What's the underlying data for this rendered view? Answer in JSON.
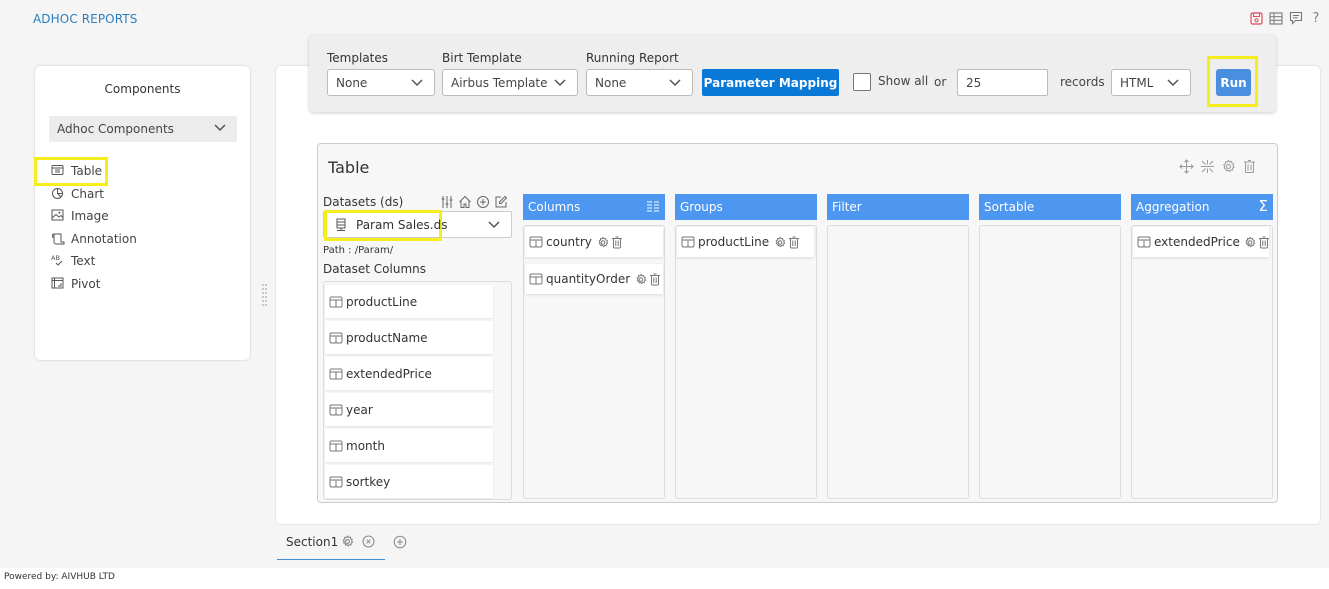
{
  "app": {
    "title": "ADHOC REPORTS",
    "top_icons": [
      "save-icon",
      "table-grid-icon",
      "comment-icon",
      "help-icon"
    ],
    "help_glyph": "?",
    "accent_color": "#2a7fc1"
  },
  "components_panel": {
    "title": "Components",
    "select_value": "Adhoc Components",
    "items": [
      {
        "label": "Table",
        "icon": "table-icon",
        "highlighted": true
      },
      {
        "label": "Chart",
        "icon": "pie-chart-icon"
      },
      {
        "label": "Image",
        "icon": "image-icon"
      },
      {
        "label": "Annotation",
        "icon": "annotation-icon"
      },
      {
        "label": "Text",
        "icon": "text-icon"
      },
      {
        "label": "Pivot",
        "icon": "pivot-icon"
      }
    ]
  },
  "toolbar": {
    "templates_label": "Templates",
    "templates_value": "None",
    "birt_label": "Birt Template",
    "birt_value": "Airbus Template",
    "running_label": "Running Report",
    "running_value": "None",
    "parameter_mapping": "Parameter Mapping",
    "show_all_label": "Show all",
    "show_all_checked": false,
    "or_label": "or",
    "records_value": "25",
    "records_label": "records",
    "format_value": "HTML",
    "run_label": "Run",
    "button_color": "#0a78d7"
  },
  "table_component": {
    "title": "Table",
    "action_icons": [
      "move-icon",
      "collapse-icon",
      "gear-icon",
      "trash-icon"
    ],
    "datasets_label": "Datasets (ds)",
    "dataset_icons": [
      "filter-sliders-icon",
      "home-icon",
      "add-circle-icon",
      "edit-icon"
    ],
    "dataset_value": "Param Sales.ds",
    "path_text": "Path : /Param/",
    "dataset_columns_label": "Dataset Columns",
    "dataset_columns": [
      "productLine",
      "productName",
      "extendedPrice",
      "year",
      "month",
      "sortkey"
    ],
    "drop_zones": [
      {
        "title": "Columns",
        "header_icon": "list-columns-icon",
        "items": [
          "country",
          "quantityOrder"
        ]
      },
      {
        "title": "Groups",
        "items": [
          "productLine"
        ]
      },
      {
        "title": "Filter",
        "items": []
      },
      {
        "title": "Sortable",
        "items": []
      },
      {
        "title": "Aggregation",
        "header_icon": "sigma-icon",
        "header_glyph": "Σ",
        "items": [
          "extendedPrice"
        ]
      }
    ],
    "header_color": "#4e97f0"
  },
  "sections": {
    "tabs": [
      {
        "label": "Section1"
      }
    ]
  },
  "footer": {
    "text": "Powered by: AIVHUB LTD"
  }
}
